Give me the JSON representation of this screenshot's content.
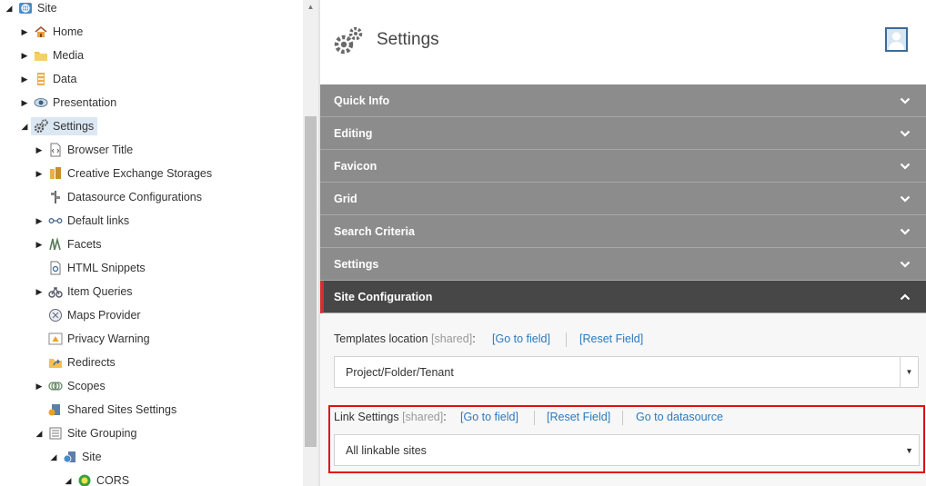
{
  "tree": {
    "items": [
      {
        "label": "Site",
        "icon": "globe-icon",
        "arrow": "expanded"
      },
      {
        "label": "Home",
        "icon": "home-icon",
        "arrow": "collapsed"
      },
      {
        "label": "Media",
        "icon": "folder-icon",
        "arrow": "collapsed"
      },
      {
        "label": "Data",
        "icon": "data-icon",
        "arrow": "collapsed"
      },
      {
        "label": "Presentation",
        "icon": "eye-icon",
        "arrow": "collapsed"
      },
      {
        "label": "Settings",
        "icon": "gears-icon",
        "arrow": "expanded",
        "selected": true
      },
      {
        "label": "Browser Title",
        "icon": "code-page-icon",
        "arrow": "collapsed"
      },
      {
        "label": "Creative Exchange Storages",
        "icon": "storage-icon",
        "arrow": "collapsed"
      },
      {
        "label": "Datasource Configurations",
        "icon": "signpost-icon",
        "arrow": "none"
      },
      {
        "label": "Default links",
        "icon": "link-icon",
        "arrow": "collapsed"
      },
      {
        "label": "Facets",
        "icon": "facets-icon",
        "arrow": "collapsed"
      },
      {
        "label": "HTML Snippets",
        "icon": "html-snippet-icon",
        "arrow": "none"
      },
      {
        "label": "Item Queries",
        "icon": "query-icon",
        "arrow": "collapsed"
      },
      {
        "label": "Maps Provider",
        "icon": "map-icon",
        "arrow": "none"
      },
      {
        "label": "Privacy Warning",
        "icon": "warning-icon",
        "arrow": "none"
      },
      {
        "label": "Redirects",
        "icon": "redirect-icon",
        "arrow": "none"
      },
      {
        "label": "Scopes",
        "icon": "scopes-icon",
        "arrow": "collapsed"
      },
      {
        "label": "Shared Sites Settings",
        "icon": "shared-sites-icon",
        "arrow": "none"
      },
      {
        "label": "Site Grouping",
        "icon": "grouping-icon",
        "arrow": "expanded"
      },
      {
        "label": "Site",
        "icon": "site-icon",
        "arrow": "expanded"
      },
      {
        "label": "CORS",
        "icon": "cors-icon",
        "arrow": "expanded"
      }
    ]
  },
  "header": {
    "title": "Settings",
    "icon": "gears-icon",
    "avatar_icon": "user-avatar-icon"
  },
  "sections": [
    {
      "label": "Quick Info",
      "state": "collapsed"
    },
    {
      "label": "Editing",
      "state": "collapsed"
    },
    {
      "label": "Favicon",
      "state": "collapsed"
    },
    {
      "label": "Grid",
      "state": "collapsed"
    },
    {
      "label": "Search Criteria",
      "state": "collapsed"
    },
    {
      "label": "Settings",
      "state": "collapsed"
    },
    {
      "label": "Site Configuration",
      "state": "expanded"
    }
  ],
  "fields": {
    "templates_location": {
      "label": "Templates location",
      "shared": "[shared]",
      "colon": ":",
      "go_to_field": "[Go to field]",
      "reset_field": "[Reset Field]",
      "value": "Project/Folder/Tenant"
    },
    "link_settings": {
      "label": "Link Settings",
      "shared": "[shared]",
      "colon": ":",
      "go_to_field": "[Go to field]",
      "reset_field": "[Reset Field]",
      "go_to_datasource": "Go to datasource",
      "value": "All linkable sites"
    }
  },
  "colors": {
    "section_bg": "#8c8c8c",
    "section_active_bg": "#474747",
    "active_accent": "#d32f2f",
    "link": "#2a7ac0",
    "highlight": "#e01010"
  }
}
